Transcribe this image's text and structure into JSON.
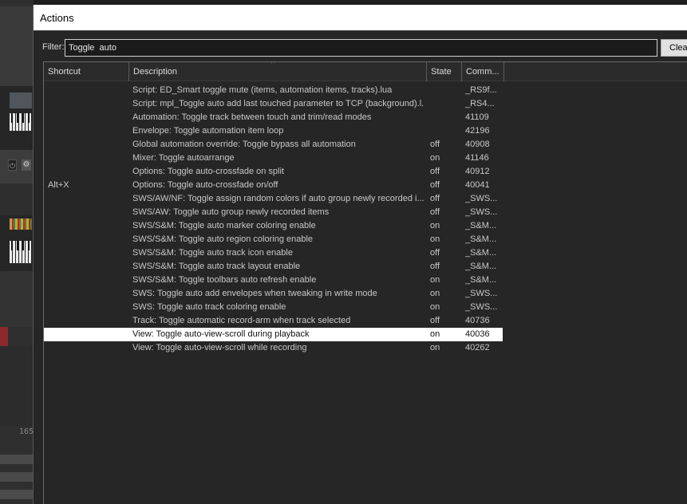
{
  "background": {
    "ruler_number": "165"
  },
  "window": {
    "title": "Actions",
    "filter_label": "Filter:",
    "filter_value": "Toggle  auto",
    "clear_label": "Clear"
  },
  "table": {
    "columns": {
      "shortcut": "Shortcut",
      "description": "Description",
      "state": "State",
      "command": "Comm..."
    },
    "sort_indicator": "^",
    "selected_index": 18,
    "rows": [
      {
        "shortcut": "",
        "description": "Script: ED_Smart toggle mute (items, automation items, tracks).lua",
        "state": "",
        "command": "_RS9f..."
      },
      {
        "shortcut": "",
        "description": "Script: mpl_Toggle auto add last touched parameter to TCP (background).l...",
        "state": "",
        "command": "_RS4..."
      },
      {
        "shortcut": "",
        "description": "Automation: Toggle track between touch and trim/read modes",
        "state": "",
        "command": "41109"
      },
      {
        "shortcut": "",
        "description": "Envelope: Toggle automation item loop",
        "state": "",
        "command": "42196"
      },
      {
        "shortcut": "",
        "description": "Global automation override: Toggle bypass all automation",
        "state": "off",
        "command": "40908"
      },
      {
        "shortcut": "",
        "description": "Mixer: Toggle autoarrange",
        "state": "on",
        "command": "41146"
      },
      {
        "shortcut": "",
        "description": "Options: Toggle auto-crossfade on split",
        "state": "off",
        "command": "40912"
      },
      {
        "shortcut": "Alt+X",
        "description": "Options: Toggle auto-crossfade on/off",
        "state": "off",
        "command": "40041"
      },
      {
        "shortcut": "",
        "description": "SWS/AW/NF: Toggle assign random colors if auto group newly recorded i...",
        "state": "off",
        "command": "_SWS..."
      },
      {
        "shortcut": "",
        "description": "SWS/AW: Toggle auto group newly recorded items",
        "state": "off",
        "command": "_SWS..."
      },
      {
        "shortcut": "",
        "description": "SWS/S&M: Toggle auto marker coloring enable",
        "state": "on",
        "command": "_S&M..."
      },
      {
        "shortcut": "",
        "description": "SWS/S&M: Toggle auto region coloring enable",
        "state": "on",
        "command": "_S&M..."
      },
      {
        "shortcut": "",
        "description": "SWS/S&M: Toggle auto track icon enable",
        "state": "off",
        "command": "_S&M..."
      },
      {
        "shortcut": "",
        "description": "SWS/S&M: Toggle auto track layout enable",
        "state": "off",
        "command": "_S&M..."
      },
      {
        "shortcut": "",
        "description": "SWS/S&M: Toggle toolbars auto refresh enable",
        "state": "on",
        "command": "_S&M..."
      },
      {
        "shortcut": "",
        "description": "SWS: Toggle auto add envelopes when tweaking in write mode",
        "state": "on",
        "command": "_SWS..."
      },
      {
        "shortcut": "",
        "description": "SWS: Toggle auto track coloring enable",
        "state": "on",
        "command": "_SWS..."
      },
      {
        "shortcut": "",
        "description": "Track: Toggle automatic record-arm when track selected",
        "state": "off",
        "command": "40736"
      },
      {
        "shortcut": "",
        "description": "View: Toggle auto-view-scroll during playback",
        "state": "on",
        "command": "40036"
      },
      {
        "shortcut": "",
        "description": "View: Toggle auto-view-scroll while recording",
        "state": "on",
        "command": "40262"
      }
    ]
  }
}
